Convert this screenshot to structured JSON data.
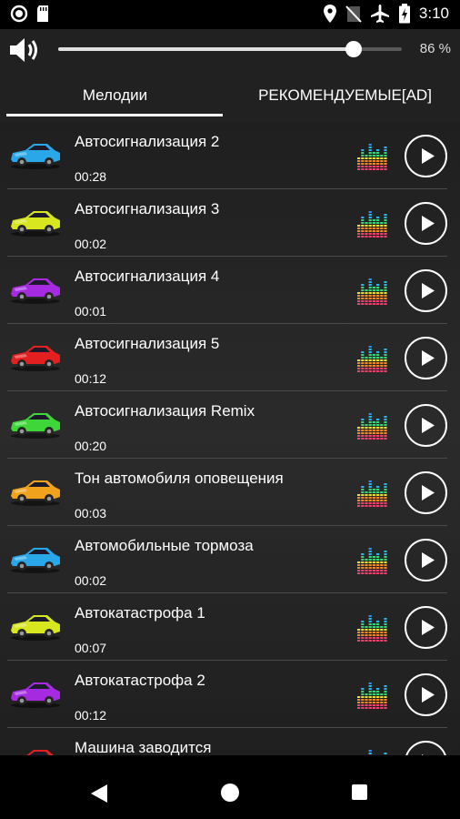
{
  "status_bar": {
    "time": "3:10",
    "left_icons": [
      "record-icon",
      "sd-card-icon"
    ],
    "right_icons": [
      "location-icon",
      "no-sim-icon",
      "airplane-icon",
      "battery-charging-icon"
    ]
  },
  "volume": {
    "percent_label": "86 %",
    "level": 0.86
  },
  "tabs": [
    {
      "label": "Мелодии",
      "selected": true
    },
    {
      "label": "РЕКОМЕНДУЕМЫЕ[AD]",
      "selected": false
    }
  ],
  "ringtones": [
    {
      "title": "Автосигнализация 2",
      "duration": "00:28",
      "car_color": "#2aa7e8"
    },
    {
      "title": "Автосигнализация 3",
      "duration": "00:02",
      "car_color": "#d7e61f"
    },
    {
      "title": "Автосигнализация 4",
      "duration": "00:01",
      "car_color": "#a62be0"
    },
    {
      "title": "Автосигнализация 5",
      "duration": "00:12",
      "car_color": "#e3201f"
    },
    {
      "title": "Автосигнализация Remix",
      "duration": "00:20",
      "car_color": "#3fd63a"
    },
    {
      "title": "Тон автомобиля оповещения",
      "duration": "00:03",
      "car_color": "#f0a21c"
    },
    {
      "title": "Автомобильные тормоза",
      "duration": "00:02",
      "car_color": "#2aa7e8"
    },
    {
      "title": "Автокатастрофа 1",
      "duration": "00:07",
      "car_color": "#d7e61f"
    },
    {
      "title": "Автокатастрофа 2",
      "duration": "00:12",
      "car_color": "#a62be0"
    },
    {
      "title": "Машина заводится",
      "duration": "",
      "car_color": "#e3201f"
    }
  ],
  "colors": {
    "list_background": "#262626",
    "header_background": "#212121",
    "accent": "#ffffff"
  },
  "nav": {
    "icons": [
      "back-icon",
      "home-icon",
      "recent-apps-icon"
    ]
  }
}
